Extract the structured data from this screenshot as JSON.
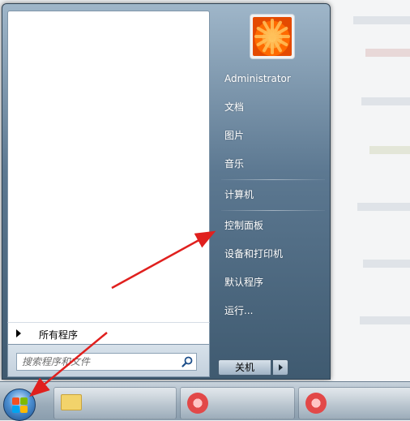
{
  "user": {
    "name": "Administrator"
  },
  "right_pane": {
    "items": [
      {
        "id": "documents",
        "label": "文档"
      },
      {
        "id": "pictures",
        "label": "图片"
      },
      {
        "id": "music",
        "label": "音乐"
      },
      {
        "id": "computer",
        "label": "计算机"
      },
      {
        "id": "control-panel",
        "label": "控制面板"
      },
      {
        "id": "devices-printers",
        "label": "设备和打印机"
      },
      {
        "id": "default-programs",
        "label": "默认程序"
      },
      {
        "id": "run",
        "label": "运行..."
      }
    ]
  },
  "left_pane": {
    "all_programs_label": "所有程序"
  },
  "search": {
    "placeholder": "搜索程序和文件",
    "value": ""
  },
  "shutdown": {
    "label": "关机"
  },
  "icons": {
    "search": "magnifier-icon",
    "start": "windows-logo-icon",
    "user": "flower-icon",
    "all_programs": "triangle-right-icon",
    "shutdown_options": "triangle-right-icon"
  },
  "colors": {
    "annotation_arrow": "#e0201e",
    "menu_text": "#ffffff"
  }
}
